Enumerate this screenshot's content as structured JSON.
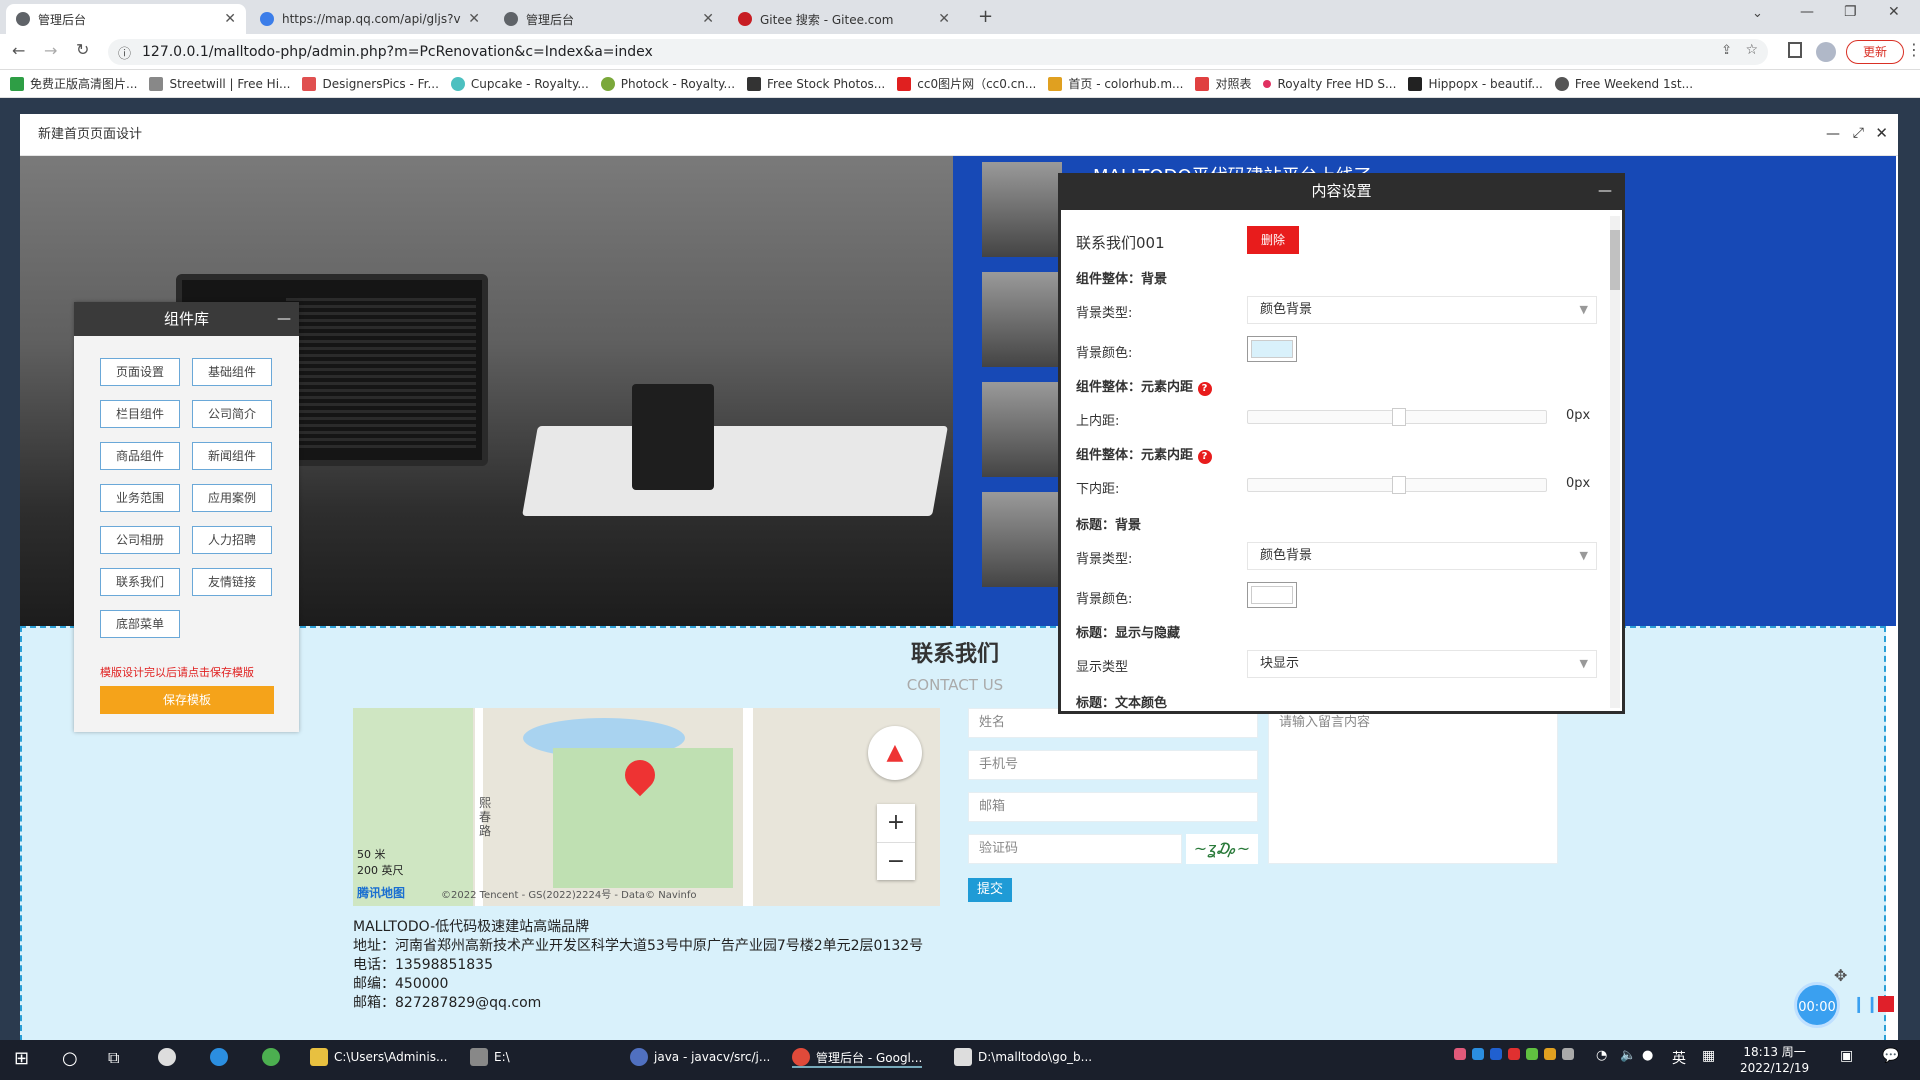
{
  "browser": {
    "tabs": [
      {
        "label": "管理后台",
        "color": "#5f6368"
      },
      {
        "label": "https://map.qq.com/api/gljs?v",
        "color": "#3b7de9"
      },
      {
        "label": "管理后台",
        "color": "#5f6368"
      },
      {
        "label": "Gitee 搜索 - Gitee.com",
        "color": "#c71d23"
      }
    ],
    "new_tab": "+",
    "url": "127.0.0.1/malltodo-php/admin.php?m=PcRenovation&c=Index&a=index",
    "update_label": "更新",
    "bookmarks": [
      {
        "label": "免费正版高清图片...",
        "color": "#2e9e45"
      },
      {
        "label": "Streetwill | Free Hi...",
        "color": "#888888"
      },
      {
        "label": "DesignersPics - Fr...",
        "color": "#e05050"
      },
      {
        "label": "Cupcake - Royalty...",
        "color": "#4cc0c0"
      },
      {
        "label": "Photock - Royalty...",
        "color": "#7aa83a"
      },
      {
        "label": "Free Stock Photos...",
        "color": "#333333"
      },
      {
        "label": "cc0图片网（cc0.cn...",
        "color": "#e02020"
      },
      {
        "label": "首页 - colorhub.m...",
        "color": "#e0a020"
      },
      {
        "label": "对照表",
        "color": "#e04040"
      },
      {
        "label": "Royalty Free HD S...",
        "color": "#e03060"
      },
      {
        "label": "Hippopx - beautif...",
        "color": "#222222"
      },
      {
        "label": "Free Weekend 1st...",
        "color": "#555555"
      }
    ]
  },
  "modal": {
    "title": "新建首页页面设计"
  },
  "banner": {
    "heading_partial": "MALLTODO平代码建站平台上线了"
  },
  "component_library": {
    "title": "组件库",
    "buttons": [
      "页面设置",
      "基础组件",
      "栏目组件",
      "公司简介",
      "商品组件",
      "新闻组件",
      "业务范围",
      "应用案例",
      "公司相册",
      "人力招聘",
      "联系我们",
      "友情链接",
      "底部菜单"
    ],
    "hint": "模版设计完以后请点击保存模版",
    "save_label": "保存模板",
    "save_color": "#f5a31a"
  },
  "content_settings": {
    "title": "内容设置",
    "component_name": "联系我们001",
    "delete_label": "删除",
    "delete_color": "#e81c1c",
    "sec1": "组件整体：背景",
    "bg_type_label": "背景类型:",
    "bg_type_value": "颜色背景",
    "bg_color_label": "背景颜色:",
    "bg_color_value": "#d9f1fb",
    "sec2": "组件整体：元素内距",
    "top_padding_label": "上内距:",
    "top_padding_value": "0px",
    "sec3": "组件整体：元素内距",
    "bottom_padding_label": "下内距:",
    "bottom_padding_value": "0px",
    "sec4": "标题：背景",
    "title_bg_type_label": "背景类型:",
    "title_bg_type_value": "颜色背景",
    "title_bg_color_label": "背景颜色:",
    "title_bg_color_value": "#ffffff",
    "sec5": "标题：显示与隐藏",
    "display_type_label": "显示类型",
    "display_type_value": "块显示",
    "sec6": "标题：文本颜色"
  },
  "contact": {
    "title": "联系我们",
    "subtitle": "CONTACT US",
    "map": {
      "street": "熙春路",
      "scale_m": "50 米",
      "scale_ft": "200 英尺",
      "brand": "腾讯地图",
      "copyright": "©2022 Tencent - GS(2022)2224号 - Data© Navinfo",
      "zoom_in": "+",
      "zoom_out": "−"
    },
    "form": {
      "name_placeholder": "姓名",
      "phone_placeholder": "手机号",
      "email_placeholder": "邮箱",
      "captcha_placeholder": "验证码",
      "message_placeholder": "请输入留言内容",
      "submit_label": "提交",
      "submit_color": "#1f9bd6"
    },
    "info": [
      "MALLTODO-低代码极速建站高端品牌",
      "地址：河南省郑州高新技术产业开发区科学大道53号中原广告产业园7号楼2单元2层0132号",
      "电话：13598851835",
      "邮编：450000",
      "邮箱：827287829@qq.com"
    ]
  },
  "recorder": {
    "time": "00:00"
  },
  "taskbar": {
    "items": [
      {
        "label": "C:\\Users\\Adminis...",
        "color": "#e8c040"
      },
      {
        "label": "E:\\",
        "color": "#888888"
      },
      {
        "label": "java - javacv/src/j...",
        "color": "#5070c0"
      },
      {
        "label": "管理后台 - Googl...",
        "color": "#e04a3a"
      },
      {
        "label": "D:\\malltodo\\go_b...",
        "color": "#dddddd"
      }
    ],
    "ime": "英",
    "time": "18:13 周一",
    "date": "2022/12/19"
  }
}
